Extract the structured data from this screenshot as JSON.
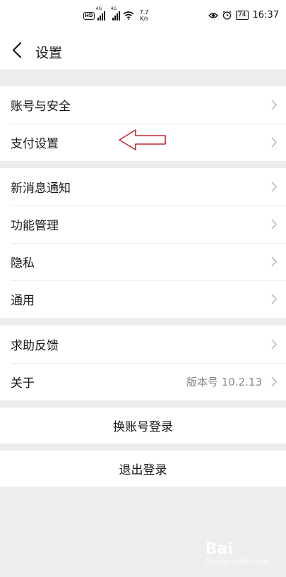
{
  "status_bar": {
    "hd_badge": "HD",
    "signal_1_label": "4G",
    "signal_2_label": "4G",
    "speed_value": "7.7",
    "speed_unit": "K/s",
    "battery": "74",
    "time": "16:37"
  },
  "header": {
    "title": "设置",
    "back_icon": "chevron-left-icon"
  },
  "groups": {
    "account": {
      "items": [
        {
          "label": "账号与安全",
          "icon": "chevron-right-icon"
        },
        {
          "label": "支付设置",
          "icon": "chevron-right-icon"
        }
      ]
    },
    "general": {
      "items": [
        {
          "label": "新消息通知"
        },
        {
          "label": "功能管理"
        },
        {
          "label": "隐私"
        },
        {
          "label": "通用"
        }
      ]
    },
    "about": {
      "items": [
        {
          "label": "求助反馈"
        },
        {
          "label": "关于",
          "value": "版本号 10.2.13"
        }
      ]
    }
  },
  "actions": {
    "switch_account": "换账号登录",
    "logout": "退出登录"
  },
  "annotation": {
    "arrow_color": "#c0262c",
    "points_to": "支付设置"
  },
  "watermark": {
    "text": "Bai",
    "sub": "jingyan.baidu.com"
  }
}
